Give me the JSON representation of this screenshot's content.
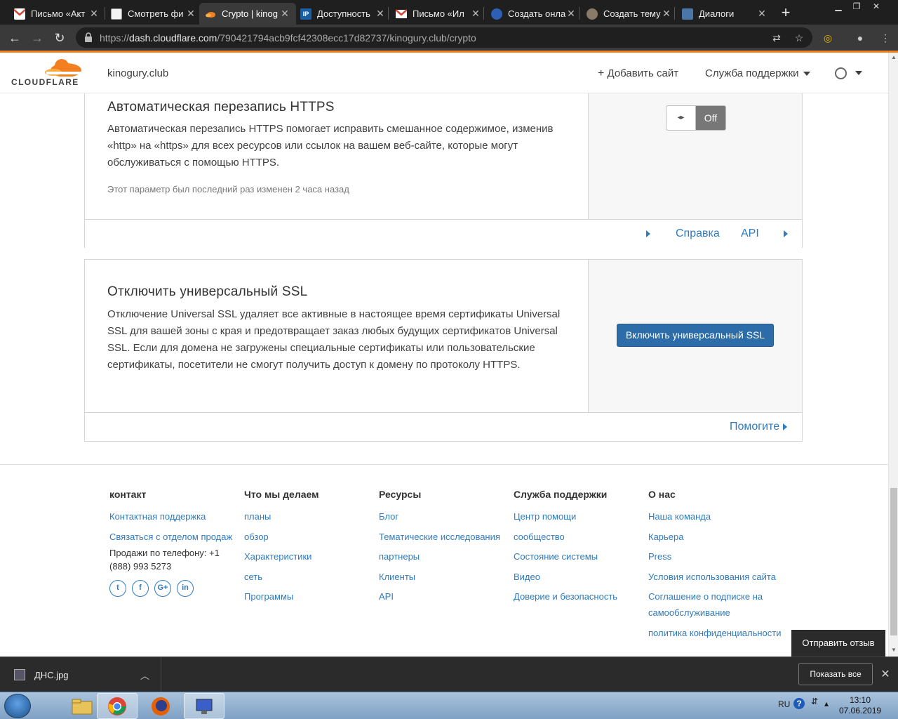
{
  "browser": {
    "tabs": [
      {
        "title": "Письмо «Акт",
        "icon": "gmail-icon",
        "active": false
      },
      {
        "title": "Смотреть фи",
        "icon": "page-icon",
        "active": false
      },
      {
        "title": "Crypto | kinog",
        "icon": "cloudflare-icon",
        "active": true
      },
      {
        "title": "Доступность",
        "icon": "ip-icon",
        "active": false
      },
      {
        "title": "Письмо «Ил",
        "icon": "gmail-icon",
        "active": false
      },
      {
        "title": "Создать онла",
        "icon": "database-icon",
        "active": false
      },
      {
        "title": "Создать тему",
        "icon": "forum-icon",
        "active": false
      },
      {
        "title": "Диалоги",
        "icon": "chat-icon",
        "active": false
      }
    ],
    "url_prefix": "https://",
    "url_host": "dash.cloudflare.com",
    "url_path": "/790421794acb9fcf42308ecc17d82737/kinogury.club/crypto"
  },
  "header": {
    "logo_text": "CLOUDFLARE",
    "site": "kinogury.club",
    "add_site": "Добавить сайт",
    "support": "Служба поддержки"
  },
  "https_card": {
    "title": "Автоматическая перезапись HTTPS",
    "description": "Автоматическая перезапись HTTPS помогает исправить смешанное содержимое, изменив «http» на «https» для всех ресурсов или ссылок на вашем веб-сайте, которые могут обслуживаться с помощью HTTPS.",
    "meta": "Этот параметр был последний раз изменен 2 часа назад",
    "toggle_state": "Off",
    "help_link": "Справка",
    "api_link": "API"
  },
  "ssl_card": {
    "title": "Отключить универсальный SSL",
    "description": "Отключение Universal SSL удаляет все активные в настоящее время сертификаты Universal SSL для вашей зоны с края и предотвращает заказ любых будущих сертификатов Universal SSL. Если для домена не загружены специальные сертификаты или пользовательские сертификаты, посетители не смогут получить доступ к домену по протоколу HTTPS.",
    "button": "Включить универсальный SSL",
    "help_link": "Помогите"
  },
  "footer": {
    "columns": [
      {
        "heading": "контакт",
        "links": [
          "Контактная поддержка",
          "Связаться с отделом продаж"
        ],
        "phone": "Продажи по телефону: +1 (888) 993 5273",
        "social": [
          "twitter",
          "facebook",
          "google-plus",
          "linkedin"
        ]
      },
      {
        "heading": "Что мы делаем",
        "links": [
          "планы",
          "обзор",
          "Характеристики",
          "сеть",
          "Программы"
        ]
      },
      {
        "heading": "Ресурсы",
        "links": [
          "Блог",
          "Тематические исследования",
          "партнеры",
          "Клиенты",
          "API"
        ]
      },
      {
        "heading": "Служба поддержки",
        "links": [
          "Центр помощи",
          "сообщество",
          "Состояние системы",
          "Видео",
          "Доверие и безопасность"
        ]
      },
      {
        "heading": "О нас",
        "links": [
          "Наша команда",
          "Карьера",
          "Press",
          "Условия использования сайта",
          "Соглашение о подписке на самообслуживание",
          "политика конфиденциальности"
        ]
      }
    ],
    "feedback_button": "Отправить отзыв"
  },
  "download_bar": {
    "file": "ДНС.jpg",
    "show_all": "Показать все"
  },
  "taskbar": {
    "language": "RU",
    "time": "13:10",
    "date": "07.06.2019"
  },
  "colors": {
    "cloudflare_orange": "#f38020",
    "link_blue": "#2f7bbf",
    "primary_button": "#2c6ca8"
  }
}
